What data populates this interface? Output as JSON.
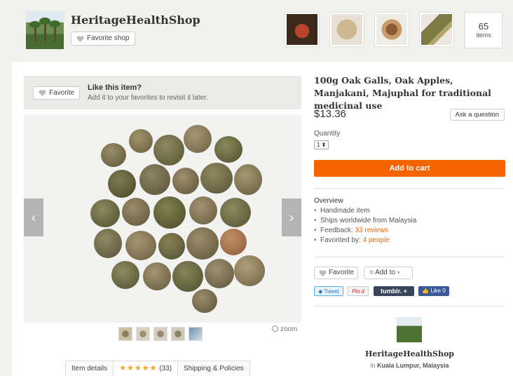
{
  "shop": {
    "name": "HeritageHealthShop",
    "favorite_label": "Favorite shop",
    "items_count": "65",
    "items_label": "items"
  },
  "like": {
    "favorite_label": "Favorite",
    "title": "Like this item?",
    "subtitle": "Add it to your favorites to revisit it later."
  },
  "gallery": {
    "zoom_label": "zoom",
    "prev_glyph": "‹",
    "next_glyph": "›"
  },
  "tabs": {
    "details": "Item details",
    "stars": "★★★★★",
    "review_count": "(33)",
    "shipping": "Shipping & Policies"
  },
  "product": {
    "title": "100g Oak Galls, Oak Apples, Manjakani, Majuphal for traditional medicinal use",
    "price": "$13.36",
    "ask_label": "Ask a question",
    "quantity_label": "Quantity",
    "quantity_value": "1 ⬍",
    "cart_label": "Add to cart"
  },
  "overview": {
    "title": "Overview",
    "handmade": "Handmade item",
    "ships": "Ships worldwide from Malaysia",
    "feedback_prefix": "Feedback: ",
    "feedback_link": "33 reviews",
    "favorited_prefix": "Favorited by: ",
    "favorited_link": "4 people"
  },
  "actions": {
    "favorite_label": "Favorite",
    "add_to_label": "Add to",
    "tweet": "Tweet",
    "pinit": "Pin it",
    "tumblr": "tumblr.",
    "like": "Like 0"
  },
  "shop_card": {
    "name": "HeritageHealthShop",
    "location_prefix": "in ",
    "location": "Kuala Lumpur, Malaysia"
  },
  "colors": {
    "accent": "#f56400",
    "star": "#f1a41f",
    "tumblr": "#36465d",
    "facebook": "#3b5998",
    "twitter": "#55acee"
  }
}
